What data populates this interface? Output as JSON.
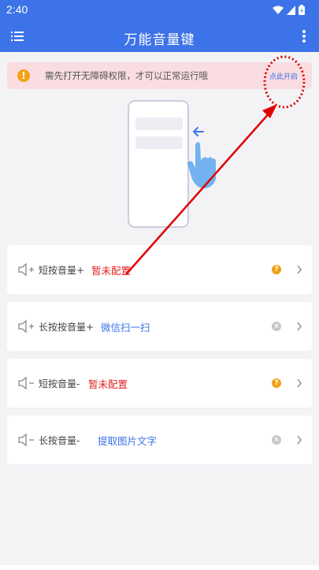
{
  "status_bar": {
    "time": "2:40"
  },
  "app_bar": {
    "title": "万能音量键"
  },
  "warning": {
    "text": "需先打开无障碍权限，才可以正常运行哦",
    "action_label": "点此开启"
  },
  "rows": [
    {
      "label": "短按音量+",
      "value": "暂未配置",
      "value_color": "red",
      "status": "question",
      "sign": "+"
    },
    {
      "label": "长按按音量+",
      "value": "微信扫一扫",
      "value_color": "blue",
      "status": "clear",
      "sign": "+"
    },
    {
      "label": "短按音量-",
      "value": "暂未配置",
      "value_color": "red",
      "status": "question",
      "sign": "-"
    },
    {
      "label": "长按音量-",
      "value": "提取图片文字",
      "value_color": "blue",
      "status": "clear",
      "sign": "-"
    }
  ],
  "colors": {
    "primary": "#3d73e8",
    "warning_bg": "#f9dde1",
    "unset_red": "#e02020",
    "annotation_red": "#e00000"
  }
}
